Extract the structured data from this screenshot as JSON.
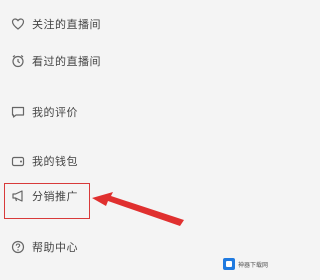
{
  "menu": {
    "items": [
      {
        "label": "关注的直播间",
        "icon": "heart-badge-icon"
      },
      {
        "label": "看过的直播间",
        "icon": "alarm-clock-icon"
      },
      {
        "label": "我的评价",
        "icon": "comment-icon"
      },
      {
        "label": "我的钱包",
        "icon": "wallet-icon"
      },
      {
        "label": "分销推广",
        "icon": "megaphone-icon"
      },
      {
        "label": "帮助中心",
        "icon": "help-icon"
      }
    ]
  },
  "annotation": {
    "highlight_color": "#d83a3a",
    "arrow_color": "#e0302f"
  },
  "watermark": {
    "text": "神器下载网"
  }
}
